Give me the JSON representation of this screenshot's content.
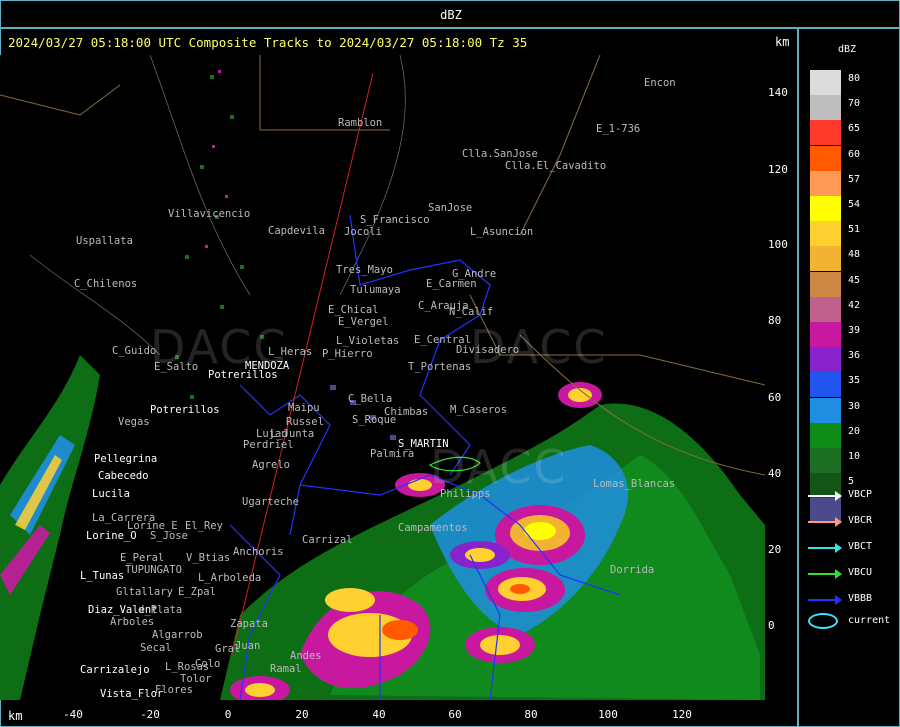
{
  "header": {
    "label": "dBZ"
  },
  "title": "2024/03/27 05:18:00 UTC Composite Tracks to 2024/03/27 05:18:00 Tz 35",
  "axis": {
    "unit_top": "km",
    "unit_bottom": "km",
    "y_ticks": [
      "140",
      "120",
      "100",
      "80",
      "60",
      "40",
      "20",
      "0"
    ],
    "x_ticks": [
      "-40",
      "-20",
      "0",
      "20",
      "40",
      "60",
      "80",
      "100",
      "120"
    ]
  },
  "watermark": {
    "left": "DACC",
    "right": "DACC",
    "bottom": "DACC"
  },
  "places": [
    "Ramblon",
    "Encon",
    "E_1-736",
    "Clla.SanJose",
    "Clla.El_Cavadito",
    "SanJose",
    "S_Francisco",
    "Jocoli",
    "L_Asuncion",
    "Villavicencio",
    "Uspallata",
    "Capdevila",
    "Tres_Mayo",
    "G_Andre",
    "Tulumaya",
    "E_Carmen",
    "C_Chilenos",
    "E_Chical",
    "C_Arauja",
    "E_Vergel",
    "N_Calif",
    "C_Guido",
    "L_Violetas",
    "E_Central",
    "Divisadero",
    "P_Hierro",
    "E_Salto",
    "MENDOZA",
    "L_Heras",
    "T_Portenas",
    "Potrerillos",
    "C_Bella",
    "Chimbas",
    "M_Caseros",
    "Potrerillos",
    "Vegas",
    "Maipu",
    "Russel",
    "Lujan",
    "L_Junta",
    "S_Roque",
    "Perdriel",
    "Palmira",
    "S_MARTIN",
    "Pellegrina",
    "Agrelo",
    "Cabecedo",
    "Lucila",
    "Ugarteche",
    "Philipps",
    "Lomas_Blancas",
    "La_Carrera",
    "Lorine_E",
    "El_Rey",
    "Lorine_O",
    "S_Jose",
    "Carrizal",
    "Campamentos",
    "E_Peral",
    "V_Btias",
    "TUPUNGATO",
    "L_Tunas",
    "L_Arboleda",
    "Anchoris",
    "Gltallary",
    "E_Zpal",
    "Dorrida",
    "Diaz_Valent",
    "d_Plata",
    "Arboles",
    "Zapata",
    "Algarrob",
    "Secal",
    "Colo",
    "Carrizalejo",
    "L_Rosas",
    "Vista_Flor",
    "Flores",
    "Tolor",
    "Ramal",
    "Gral",
    "Juan",
    "Andes"
  ],
  "legend": {
    "title": "dBZ",
    "levels": [
      {
        "value": "80",
        "color": "#dcdcdc"
      },
      {
        "value": "70",
        "color": "#bebebe"
      },
      {
        "value": "65",
        "color": "#ff3a2a"
      },
      {
        "value": "60",
        "color": "#ff5a00"
      },
      {
        "value": "57",
        "color": "#ff9955"
      },
      {
        "value": "54",
        "color": "#ffff00"
      },
      {
        "value": "51",
        "color": "#ffd030"
      },
      {
        "value": "48",
        "color": "#f2b333"
      },
      {
        "value": "45",
        "color": "#cc8844"
      },
      {
        "value": "42",
        "color": "#c0608c"
      },
      {
        "value": "39",
        "color": "#c818a0"
      },
      {
        "value": "36",
        "color": "#8822cc"
      },
      {
        "value": "35",
        "color": "#2255ee"
      },
      {
        "value": "30",
        "color": "#1f8ee0"
      },
      {
        "value": "20",
        "color": "#0f8c18"
      },
      {
        "value": "10",
        "color": "#1b6e22"
      },
      {
        "value": "5",
        "color": "#145618"
      },
      {
        "value": "",
        "color": "#4a4a8c"
      }
    ],
    "tracks": [
      {
        "label": "VBCP",
        "color": "#ffffff"
      },
      {
        "label": "VBCR",
        "color": "#ff9977"
      },
      {
        "label": "VBCT",
        "color": "#33e6e6"
      },
      {
        "label": "VBCU",
        "color": "#33dd33"
      },
      {
        "label": "VBBB",
        "color": "#2233ff"
      }
    ],
    "current_label": "current",
    "current_color": "#3fe0ff"
  }
}
